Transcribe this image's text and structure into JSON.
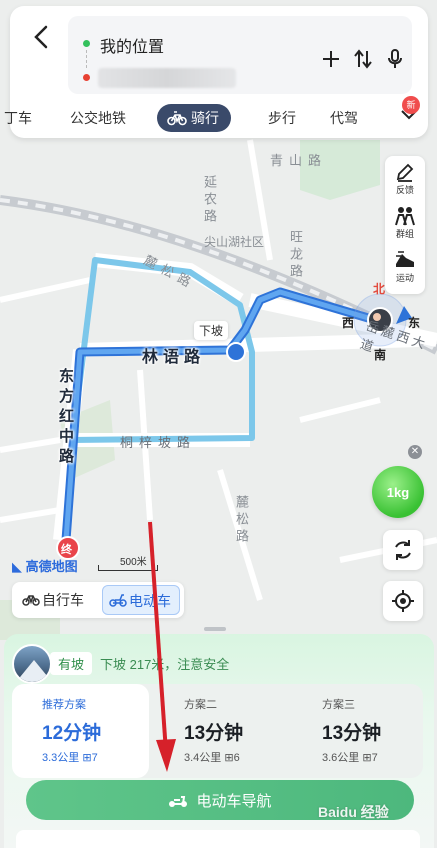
{
  "header": {
    "back_icon": "back-chevron-icon",
    "origin": "我的位置",
    "actions": [
      "add-icon",
      "swap-icon",
      "mic-icon"
    ]
  },
  "modes": {
    "items": [
      {
        "label": "丁车"
      },
      {
        "label": "公交地铁"
      },
      {
        "label": "骑行",
        "active": true
      },
      {
        "label": "步行"
      },
      {
        "label": "代驾"
      }
    ],
    "new_badge": "新"
  },
  "map": {
    "roads": [
      "青山路",
      "延农路",
      "尖山湖社区",
      "旺龙路",
      "麓松路",
      "林语路",
      "桐梓坡路",
      "麓松路",
      "东方红中路",
      "岳麓西大道"
    ],
    "down_slope": "下坡",
    "compass": {
      "n": "北",
      "w": "西",
      "e": "东",
      "s": "南"
    },
    "end_marker": "终",
    "logo": "高德地图",
    "scale": "500米"
  },
  "toolbar": {
    "feedback": "反馈",
    "group": "群组",
    "sport": "运动"
  },
  "ebike_badge": "1kg",
  "vehicle_tabs": {
    "bike": "自行车",
    "ebike": "电动车"
  },
  "sheet": {
    "slope_tag": "有坡",
    "slope_desc": "下坡 217米，注意安全",
    "plans": [
      {
        "name": "推荐方案",
        "time": "12分钟",
        "meta": "3.3公里 ⊞7"
      },
      {
        "name": "方案二",
        "time": "13分钟",
        "meta": "3.4公里 ⊞6"
      },
      {
        "name": "方案三",
        "time": "13分钟",
        "meta": "3.6公里 ⊞7"
      }
    ],
    "nav_button": "电动车导航"
  },
  "watermark": "Baidu 经验"
}
